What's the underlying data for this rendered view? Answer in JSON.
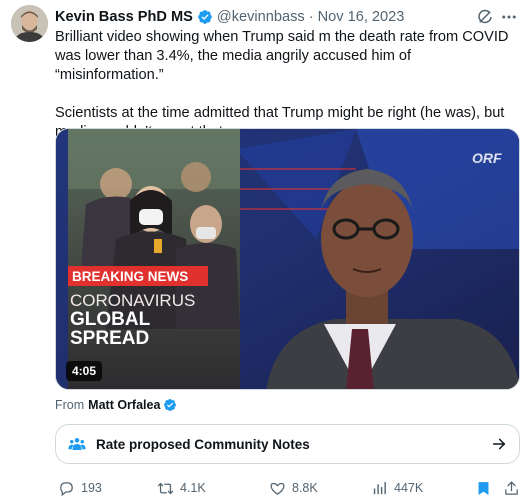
{
  "author": {
    "name": "Kevin Bass PhD MS",
    "handle": "@kevinnbass",
    "separator": "·",
    "date": "Nov 16, 2023",
    "verified": true
  },
  "tweet": {
    "paragraph1": "Brilliant video showing when Trump said m the death rate from COVID was lower than 3.4%, the media angrily accused him of “misinformation.”",
    "paragraph2": "Scientists at the time admitted that Trump might be right (he was), but media wouldn’t report that."
  },
  "video": {
    "duration": "4:05",
    "breaking_news": "BREAKING NEWS",
    "line1": "CORONAVIRUS",
    "line2": "GLOBAL",
    "line3": "SPREAD",
    "channel_logo": "ORF"
  },
  "from": {
    "prefix": "From",
    "name": "Matt Orfalea"
  },
  "community_notes": {
    "label": "Rate proposed Community Notes"
  },
  "actions": {
    "replies": "193",
    "retweets": "4.1K",
    "likes": "8.8K",
    "views": "447K"
  },
  "colors": {
    "verified_blue": "#1d9bf0",
    "secondary_text": "#536471",
    "bookmark_blue": "#1d9bf0",
    "breaking_red": "#e0312f"
  },
  "icons": [
    "verified-icon",
    "grok-icon",
    "more-icon",
    "people-icon",
    "arrow-right-icon",
    "reply-icon",
    "retweet-icon",
    "like-icon",
    "views-icon",
    "bookmark-icon",
    "share-icon"
  ]
}
